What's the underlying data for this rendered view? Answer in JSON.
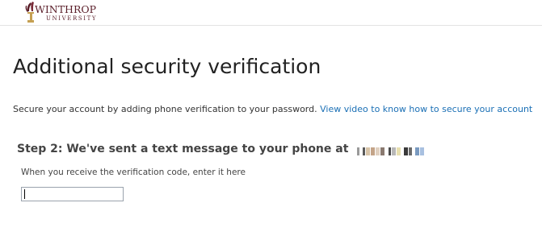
{
  "header": {
    "logo_word": "WINTHROP",
    "logo_sub": "UNIVERSITY",
    "brand_color": "#5b1f2a"
  },
  "page": {
    "title": "Additional security verification",
    "intro_text": "Secure your account by adding phone verification to your password. ",
    "intro_link": "View video to know how to secure your account",
    "link_color": "#1a6fb5"
  },
  "step": {
    "label": "Step 2: We've sent a text message to your phone at"
  },
  "verification": {
    "instruction": "When you receive the verification code, enter it here",
    "code_value": "",
    "code_placeholder": ""
  }
}
